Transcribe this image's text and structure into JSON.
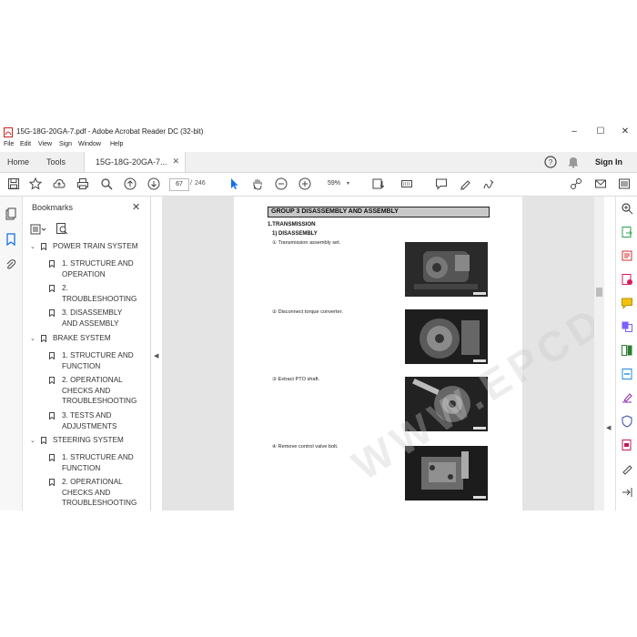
{
  "window": {
    "title": "15G-18G-20GA-7.pdf - Adobe Acrobat Reader DC (32-bit)",
    "controls": {
      "minimize": "–",
      "maximize": "☐",
      "close": "✕"
    }
  },
  "menu": [
    "File",
    "Edit",
    "View",
    "Sign",
    "Window",
    "Help"
  ],
  "tabs": {
    "home": "Home",
    "tools": "Tools",
    "document": "15G-18G-20GA-7...",
    "close": "✕",
    "sign_in": "Sign In"
  },
  "toolbar": {
    "page_current": "67",
    "page_separator": "/",
    "page_total": "246",
    "zoom": "59%"
  },
  "bookmarks": {
    "title": "Bookmarks",
    "close": "✕",
    "items": [
      {
        "level": 0,
        "label": "POWER TRAIN SYSTEM"
      },
      {
        "level": 1,
        "label": "1. STRUCTURE AND"
      },
      {
        "level": 1,
        "label": "OPERATION"
      },
      {
        "level": 1,
        "label": "2."
      },
      {
        "level": 1,
        "label": "TROUBLESHOOTING"
      },
      {
        "level": 1,
        "label": "3. DISASSEMBLY"
      },
      {
        "level": 1,
        "label": "AND ASSEMBLY"
      },
      {
        "level": 0,
        "label": "BRAKE SYSTEM"
      },
      {
        "level": 1,
        "label": "1. STRUCTURE AND"
      },
      {
        "level": 1,
        "label": "FUNCTION"
      },
      {
        "level": 1,
        "label": "2. OPERATIONAL"
      },
      {
        "level": 1,
        "label": "CHECKS AND"
      },
      {
        "level": 1,
        "label": "TROUBLESHOOTING"
      },
      {
        "level": 1,
        "label": "3. TESTS AND"
      },
      {
        "level": 1,
        "label": "ADJUSTMENTS"
      },
      {
        "level": 0,
        "label": "STEERING SYSTEM"
      },
      {
        "level": 1,
        "label": "1. STRUCTURE AND"
      },
      {
        "level": 1,
        "label": "FUNCTION"
      },
      {
        "level": 1,
        "label": "2. OPERATIONAL"
      },
      {
        "level": 1,
        "label": "CHECKS AND"
      },
      {
        "level": 1,
        "label": "TROUBLESHOOTING"
      }
    ]
  },
  "document": {
    "group_heading": "GROUP  3  DISASSEMBLY AND ASSEMBLY",
    "section": "1.TRANSMISSION",
    "subsection": "1) DISASSEMBLY",
    "steps": [
      "① Transmission assembly set.",
      "② Disconnect torque converter.",
      "③ Extract PTO shaft.",
      "④ Remove control valve bolt."
    ],
    "watermark": "WWW.EPCDERB.COM"
  },
  "colors": {
    "accent": "#1473e6",
    "group_bar": "#c8c8c8",
    "doc_bg": "#e4e4e4"
  }
}
